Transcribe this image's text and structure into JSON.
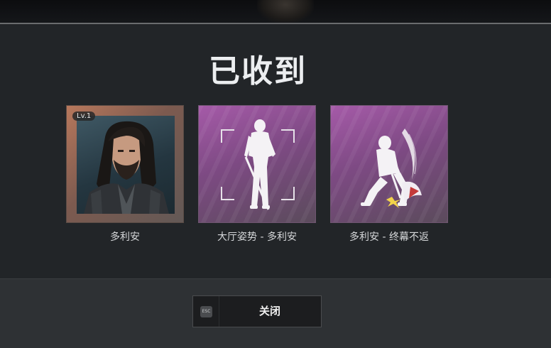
{
  "dialog": {
    "title": "已收到",
    "rewards": [
      {
        "label": "多利安",
        "badge": "Lv.1",
        "kind": "character-portrait",
        "frame_color": "#b8785c"
      },
      {
        "label": "大厅姿势 - 多利安",
        "kind": "lobby-pose",
        "frame_color": "#a55aa8"
      },
      {
        "label": "多利安 - 终幕不返",
        "kind": "finisher-emote",
        "frame_color": "#a55aa8"
      }
    ]
  },
  "footer": {
    "close_label": "关闭",
    "esc_hint": "ESC"
  },
  "colors": {
    "background": "#222528",
    "footer": "#2e3134",
    "title": "#eceef0"
  }
}
